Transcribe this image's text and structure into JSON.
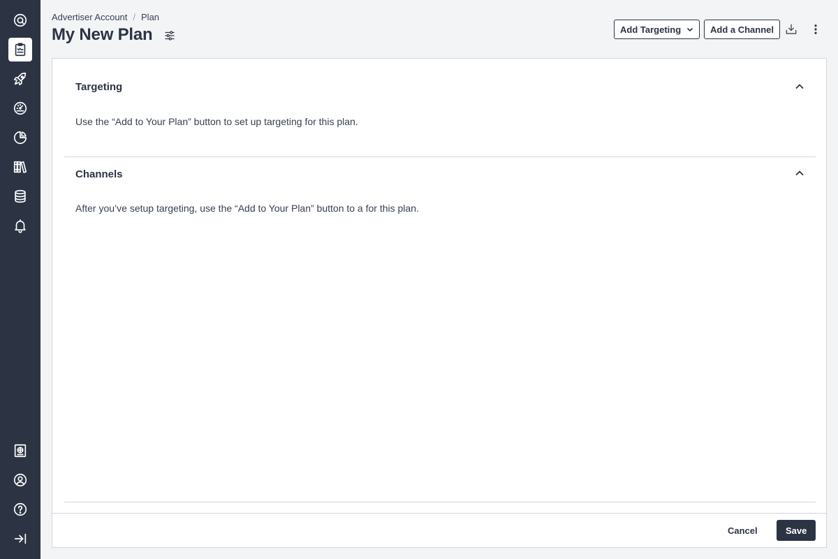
{
  "sidebar": {
    "items": [
      {
        "icon": "logo-q-icon"
      },
      {
        "icon": "clipboard-icon",
        "active": true
      },
      {
        "icon": "rocket-icon"
      },
      {
        "icon": "gauge-icon"
      },
      {
        "icon": "pie-chart-icon"
      },
      {
        "icon": "library-icon"
      },
      {
        "icon": "database-icon"
      },
      {
        "icon": "bell-icon"
      }
    ],
    "bottom_items": [
      {
        "icon": "newspaper-icon"
      },
      {
        "icon": "user-circle-icon"
      },
      {
        "icon": "help-circle-icon"
      },
      {
        "icon": "expand-sidebar-icon"
      }
    ]
  },
  "header": {
    "breadcrumb": [
      "Advertiser Account",
      "Plan"
    ],
    "breadcrumb_separator": "/",
    "title": "My New Plan",
    "add_targeting_label": "Add Targeting",
    "add_channel_label": "Add a Channel"
  },
  "sections": {
    "targeting": {
      "title": "Targeting",
      "text": "Use the “Add to Your Plan” button to set up targeting for this plan."
    },
    "channels": {
      "title": "Channels",
      "text": "After you’ve setup targeting, use the “Add to Your Plan” button to a for this plan."
    }
  },
  "footer": {
    "cancel_label": "Cancel",
    "save_label": "Save"
  },
  "colors": {
    "sidebar_bg": "#2c3444",
    "primary": "#2c3444",
    "page_bg": "#f3f4f6",
    "border": "#d1d5db"
  }
}
